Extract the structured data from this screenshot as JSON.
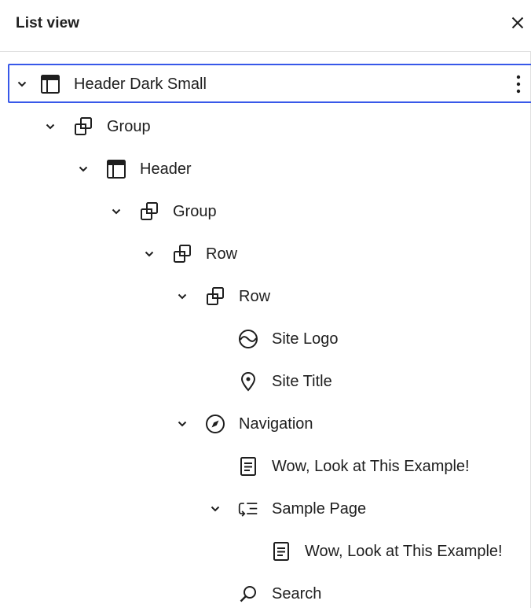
{
  "panel": {
    "title": "List view",
    "close_icon": "close-icon"
  },
  "tree": [
    {
      "label": "Header Dark Small",
      "icon": "template-part-icon",
      "depth": 0,
      "expandable": true,
      "selected": true
    },
    {
      "label": "Group",
      "icon": "group-icon",
      "depth": 1,
      "expandable": true
    },
    {
      "label": "Header",
      "icon": "template-part-icon",
      "depth": 2,
      "expandable": true
    },
    {
      "label": "Group",
      "icon": "group-icon",
      "depth": 3,
      "expandable": true
    },
    {
      "label": "Row",
      "icon": "group-icon",
      "depth": 4,
      "expandable": true
    },
    {
      "label": "Row",
      "icon": "group-icon",
      "depth": 5,
      "expandable": true
    },
    {
      "label": "Site Logo",
      "icon": "site-logo-icon",
      "depth": 6,
      "expandable": false
    },
    {
      "label": "Site Title",
      "icon": "map-marker-icon",
      "depth": 6,
      "expandable": false
    },
    {
      "label": "Navigation",
      "icon": "navigation-icon",
      "depth": 5,
      "expandable": true
    },
    {
      "label": "Wow, Look at This Example!",
      "icon": "page-icon",
      "depth": 6,
      "expandable": false
    },
    {
      "label": "Sample Page",
      "icon": "submenu-icon",
      "depth": 6,
      "expandable": true
    },
    {
      "label": "Wow, Look at This Example!",
      "icon": "page-icon",
      "depth": 7,
      "expandable": false
    },
    {
      "label": "Search",
      "icon": "search-icon",
      "depth": 6,
      "expandable": false
    }
  ],
  "colors": {
    "accent": "#3858e9",
    "text": "#1e1e1e",
    "divider": "#e0e0e0"
  }
}
